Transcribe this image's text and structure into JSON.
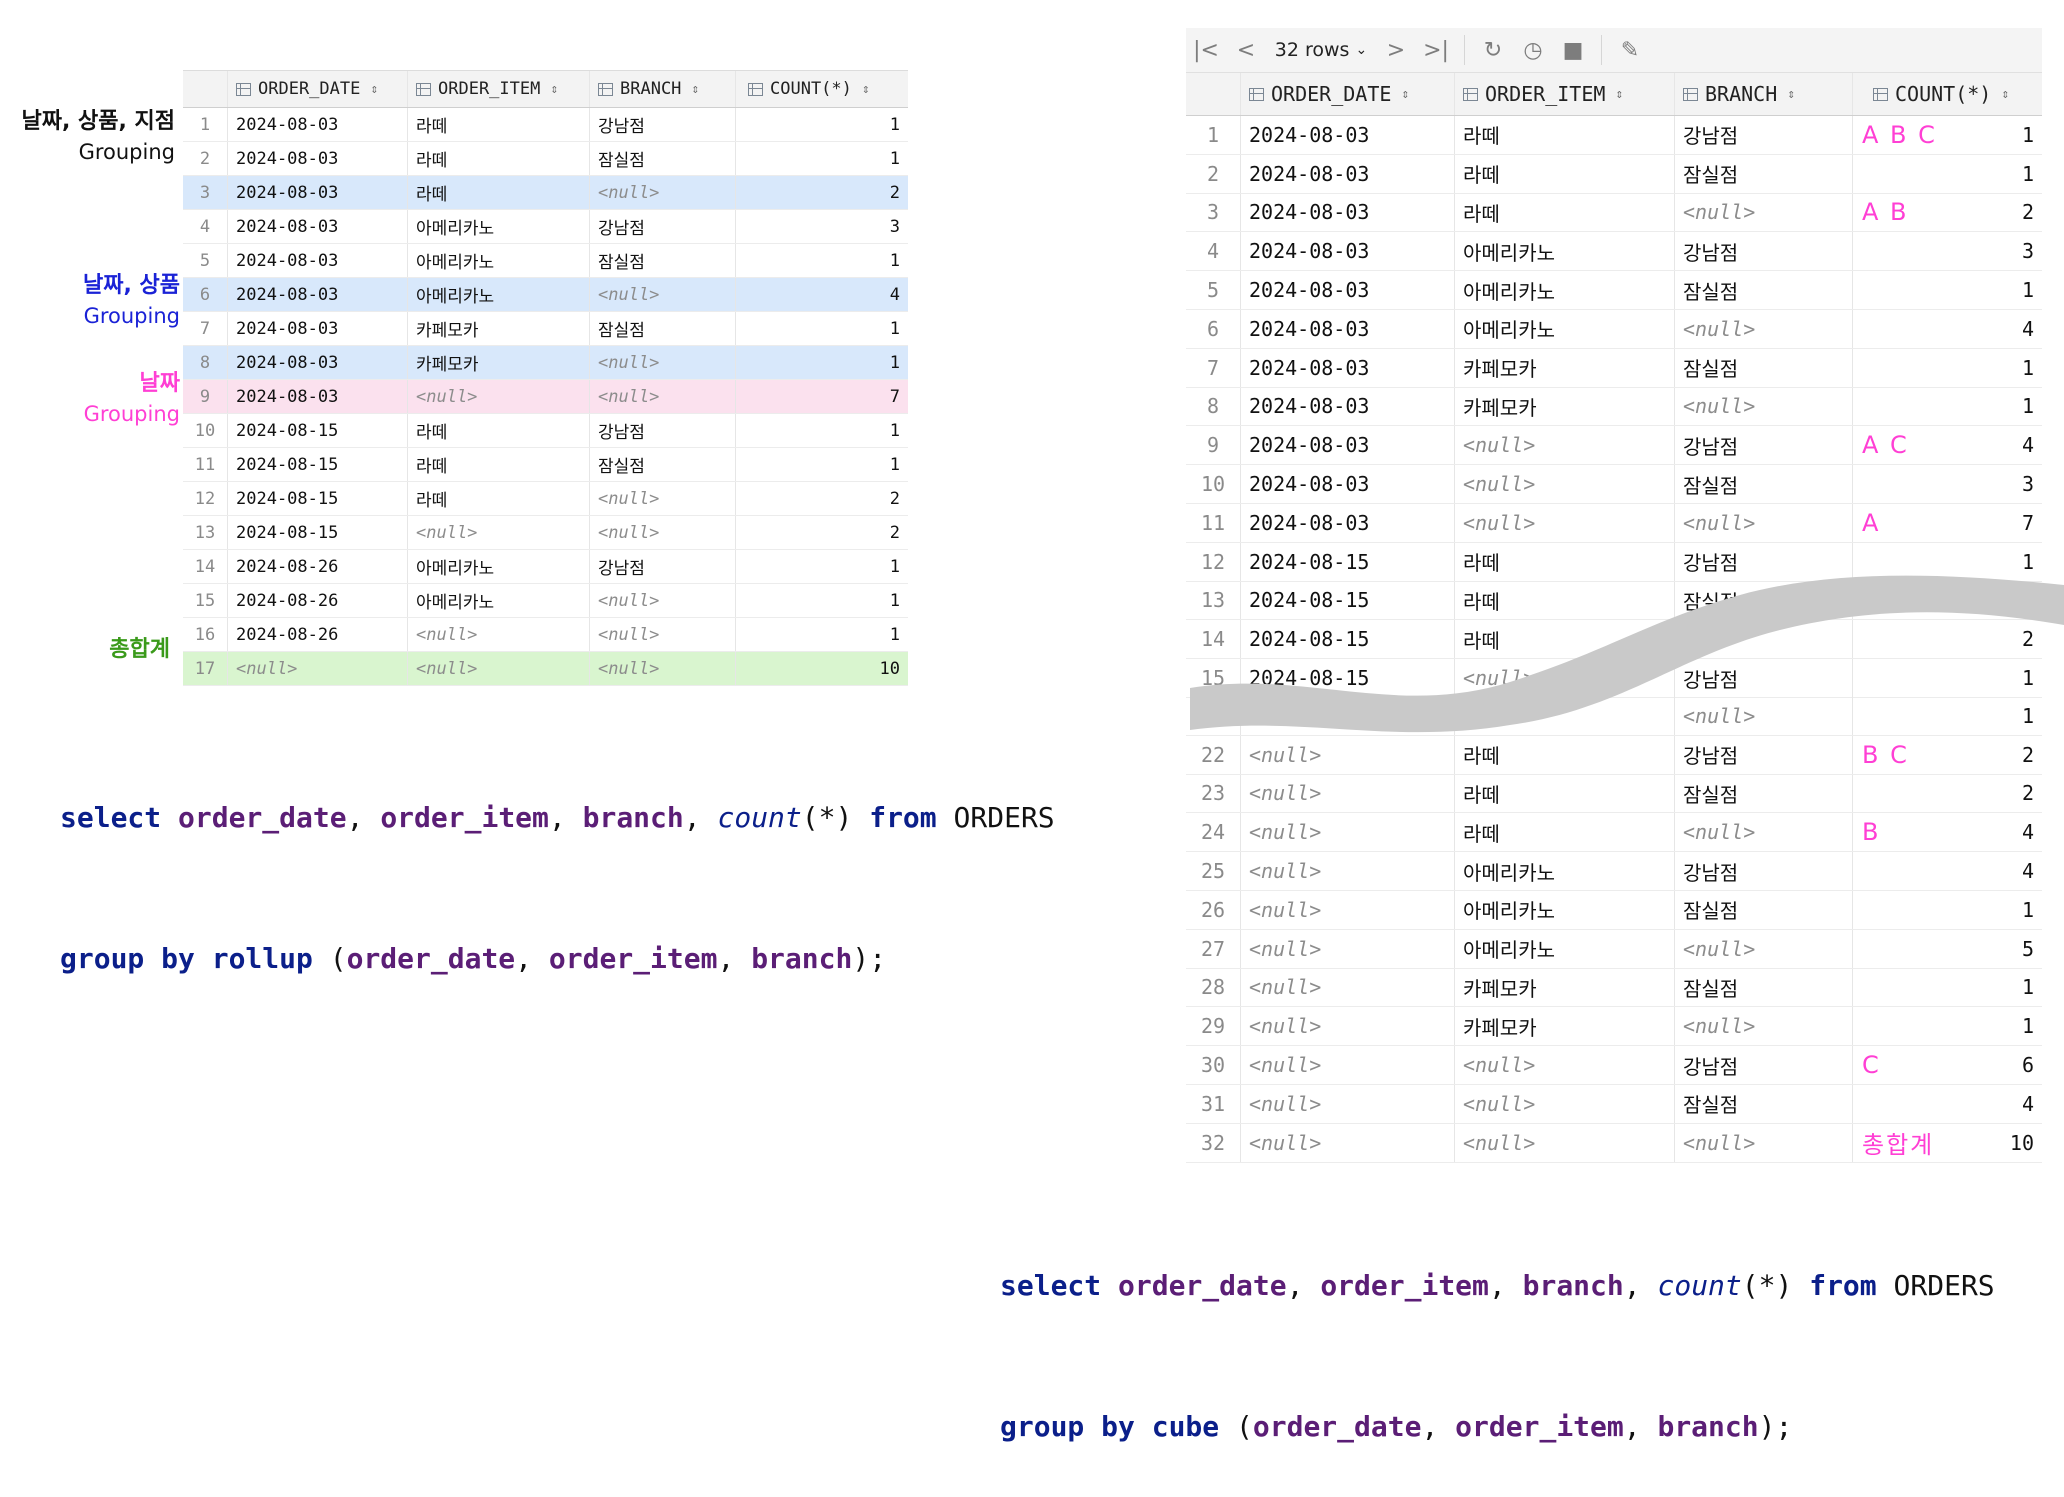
{
  "left": {
    "columns": [
      "ORDER_DATE",
      "ORDER_ITEM",
      "BRANCH",
      "COUNT(*)"
    ],
    "null_text": "<null>",
    "rows": [
      {
        "n": "1",
        "date": "2024-08-03",
        "item": "라떼",
        "branch": "강남점",
        "count": "1"
      },
      {
        "n": "2",
        "date": "2024-08-03",
        "item": "라떼",
        "branch": "잠실점",
        "count": "1"
      },
      {
        "n": "3",
        "date": "2024-08-03",
        "item": "라떼",
        "branch": "<null>",
        "count": "2"
      },
      {
        "n": "4",
        "date": "2024-08-03",
        "item": "아메리카노",
        "branch": "강남점",
        "count": "3"
      },
      {
        "n": "5",
        "date": "2024-08-03",
        "item": "아메리카노",
        "branch": "잠실점",
        "count": "1"
      },
      {
        "n": "6",
        "date": "2024-08-03",
        "item": "아메리카노",
        "branch": "<null>",
        "count": "4"
      },
      {
        "n": "7",
        "date": "2024-08-03",
        "item": "카페모카",
        "branch": "잠실점",
        "count": "1"
      },
      {
        "n": "8",
        "date": "2024-08-03",
        "item": "카페모카",
        "branch": "<null>",
        "count": "1"
      },
      {
        "n": "9",
        "date": "2024-08-03",
        "item": "<null>",
        "branch": "<null>",
        "count": "7"
      },
      {
        "n": "10",
        "date": "2024-08-15",
        "item": "라떼",
        "branch": "강남점",
        "count": "1"
      },
      {
        "n": "11",
        "date": "2024-08-15",
        "item": "라떼",
        "branch": "잠실점",
        "count": "1"
      },
      {
        "n": "12",
        "date": "2024-08-15",
        "item": "라떼",
        "branch": "<null>",
        "count": "2"
      },
      {
        "n": "13",
        "date": "2024-08-15",
        "item": "<null>",
        "branch": "<null>",
        "count": "2"
      },
      {
        "n": "14",
        "date": "2024-08-26",
        "item": "아메리카노",
        "branch": "강남점",
        "count": "1"
      },
      {
        "n": "15",
        "date": "2024-08-26",
        "item": "아메리카노",
        "branch": "<null>",
        "count": "1"
      },
      {
        "n": "16",
        "date": "2024-08-26",
        "item": "<null>",
        "branch": "<null>",
        "count": "1"
      },
      {
        "n": "17",
        "date": "<null>",
        "item": "<null>",
        "branch": "<null>",
        "count": "10"
      }
    ],
    "annotations": {
      "a1_line1": "날짜, 상품, 지점",
      "a1_line2": "Grouping",
      "a2_line1": "날짜, 상품",
      "a2_line2": "Grouping",
      "a3_line1": "날짜",
      "a3_line2": "Grouping",
      "a4_line1": "총합계"
    },
    "sql_line1": [
      "select",
      " ",
      "order_date",
      ", ",
      "order_item",
      ", ",
      "branch",
      ", ",
      "count",
      "(*) ",
      "from",
      " ORDERS"
    ],
    "sql_line2": [
      "group by rollup",
      " (",
      "order_date",
      ", ",
      "order_item",
      ", ",
      "branch",
      ");"
    ]
  },
  "right": {
    "toolbar": {
      "rows_label": "32 rows"
    },
    "columns": [
      "ORDER_DATE",
      "ORDER_ITEM",
      "BRANCH",
      "COUNT(*)"
    ],
    "rows_top": [
      {
        "n": "1",
        "date": "2024-08-03",
        "item": "라떼",
        "branch": "강남점",
        "count": "1",
        "tag": "A B C"
      },
      {
        "n": "2",
        "date": "2024-08-03",
        "item": "라떼",
        "branch": "잠실점",
        "count": "1",
        "tag": ""
      },
      {
        "n": "3",
        "date": "2024-08-03",
        "item": "라떼",
        "branch": "<null>",
        "count": "2",
        "tag": "A B"
      },
      {
        "n": "4",
        "date": "2024-08-03",
        "item": "아메리카노",
        "branch": "강남점",
        "count": "3",
        "tag": ""
      },
      {
        "n": "5",
        "date": "2024-08-03",
        "item": "아메리카노",
        "branch": "잠실점",
        "count": "1",
        "tag": ""
      },
      {
        "n": "6",
        "date": "2024-08-03",
        "item": "아메리카노",
        "branch": "<null>",
        "count": "4",
        "tag": ""
      },
      {
        "n": "7",
        "date": "2024-08-03",
        "item": "카페모카",
        "branch": "잠실점",
        "count": "1",
        "tag": ""
      },
      {
        "n": "8",
        "date": "2024-08-03",
        "item": "카페모카",
        "branch": "<null>",
        "count": "1",
        "tag": ""
      },
      {
        "n": "9",
        "date": "2024-08-03",
        "item": "<null>",
        "branch": "강남점",
        "count": "4",
        "tag": "A C"
      },
      {
        "n": "10",
        "date": "2024-08-03",
        "item": "<null>",
        "branch": "잠실점",
        "count": "3",
        "tag": ""
      },
      {
        "n": "11",
        "date": "2024-08-03",
        "item": "<null>",
        "branch": "<null>",
        "count": "7",
        "tag": "A"
      },
      {
        "n": "12",
        "date": "2024-08-15",
        "item": "라떼",
        "branch": "강남점",
        "count": "1",
        "tag": ""
      },
      {
        "n": "13",
        "date": "2024-08-15",
        "item": "라떼",
        "branch": "잠실점",
        "count": "",
        "tag": ""
      },
      {
        "n": "14",
        "date": "2024-08-15",
        "item": "라떼",
        "branch": "",
        "count": "2",
        "tag": ""
      },
      {
        "n": "15",
        "date": "2024-08-15",
        "item": "<null>",
        "branch": "강남점",
        "count": "1",
        "tag": ""
      }
    ],
    "rows_bottom": [
      {
        "n": "",
        "date": "",
        "item": "",
        "branch": "<null>",
        "count": "1",
        "tag": ""
      },
      {
        "n": "22",
        "date": "<null>",
        "item": "라떼",
        "branch": "강남점",
        "count": "2",
        "tag": "B C"
      },
      {
        "n": "23",
        "date": "<null>",
        "item": "라떼",
        "branch": "잠실점",
        "count": "2",
        "tag": ""
      },
      {
        "n": "24",
        "date": "<null>",
        "item": "라떼",
        "branch": "<null>",
        "count": "4",
        "tag": "B"
      },
      {
        "n": "25",
        "date": "<null>",
        "item": "아메리카노",
        "branch": "강남점",
        "count": "4",
        "tag": ""
      },
      {
        "n": "26",
        "date": "<null>",
        "item": "아메리카노",
        "branch": "잠실점",
        "count": "1",
        "tag": ""
      },
      {
        "n": "27",
        "date": "<null>",
        "item": "아메리카노",
        "branch": "<null>",
        "count": "5",
        "tag": ""
      },
      {
        "n": "28",
        "date": "<null>",
        "item": "카페모카",
        "branch": "잠실점",
        "count": "1",
        "tag": ""
      },
      {
        "n": "29",
        "date": "<null>",
        "item": "카페모카",
        "branch": "<null>",
        "count": "1",
        "tag": ""
      },
      {
        "n": "30",
        "date": "<null>",
        "item": "<null>",
        "branch": "강남점",
        "count": "6",
        "tag": "C"
      },
      {
        "n": "31",
        "date": "<null>",
        "item": "<null>",
        "branch": "잠실점",
        "count": "4",
        "tag": ""
      },
      {
        "n": "32",
        "date": "<null>",
        "item": "<null>",
        "branch": "<null>",
        "count": "10",
        "tag": "총합계"
      }
    ],
    "sql_line1": [
      "select",
      " ",
      "order_date",
      ", ",
      "order_item",
      ", ",
      "branch",
      ", ",
      "count",
      "(*) ",
      "from",
      " ORDERS"
    ],
    "sql_line2": [
      "group by cube",
      " (",
      "order_date",
      ", ",
      "order_item",
      ", ",
      "branch",
      ");"
    ]
  },
  "colors": {
    "annotation_black": "#111111",
    "annotation_blue": "#1a22d6",
    "annotation_magenta": "#ff3fd4",
    "annotation_green": "#3a9a1a",
    "highlight_blue": "#d8e8fb",
    "highlight_pink": "#fbe1ee",
    "highlight_green": "#d9f5cf"
  }
}
